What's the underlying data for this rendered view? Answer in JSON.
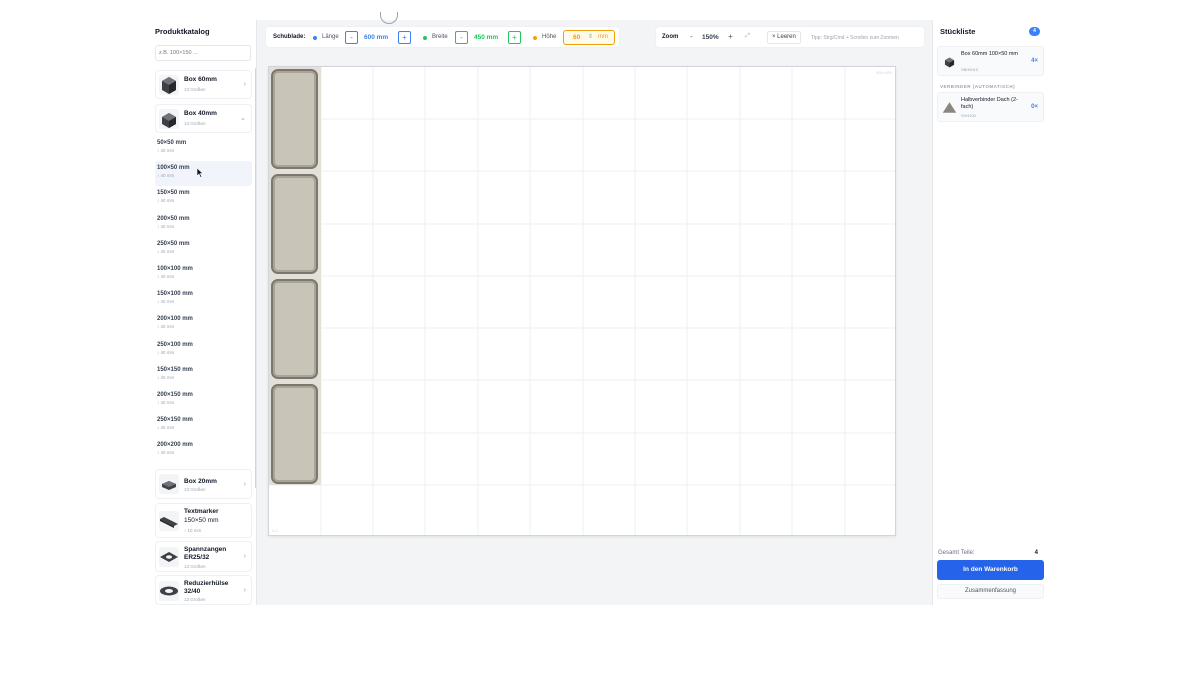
{
  "sidebar": {
    "title": "Produktkatalog",
    "search_placeholder": "z.B. 100×150 ...",
    "categories_top": [
      {
        "name": "Box 60mm",
        "sub": "13 Größen",
        "expanded": false
      },
      {
        "name": "Box 40mm",
        "sub": "13 Größen",
        "expanded": true
      }
    ],
    "sizes": [
      {
        "name": "50×50 mm",
        "h": "↕ 40 mm"
      },
      {
        "name": "100×50 mm",
        "h": "↕ 40 mm"
      },
      {
        "name": "150×50 mm",
        "h": "↕ 40 mm"
      },
      {
        "name": "200×50 mm",
        "h": "↕ 40 mm"
      },
      {
        "name": "250×50 mm",
        "h": "↕ 40 mm"
      },
      {
        "name": "100×100 mm",
        "h": "↕ 40 mm"
      },
      {
        "name": "150×100 mm",
        "h": "↕ 40 mm"
      },
      {
        "name": "200×100 mm",
        "h": "↕ 40 mm"
      },
      {
        "name": "250×100 mm",
        "h": "↕ 40 mm"
      },
      {
        "name": "150×150 mm",
        "h": "↕ 40 mm"
      },
      {
        "name": "200×150 mm",
        "h": "↕ 40 mm"
      },
      {
        "name": "250×150 mm",
        "h": "↕ 40 mm"
      },
      {
        "name": "200×200 mm",
        "h": "↕ 40 mm"
      }
    ],
    "categories_bottom": [
      {
        "name": "Box 20mm",
        "sub": "13 Größen"
      },
      {
        "name": "Textmarker",
        "name2": "150×50 mm",
        "sub": "↕ 10 mm"
      },
      {
        "name": "Spannzangen",
        "name2": "ER25/32",
        "sub": "13 Größen"
      },
      {
        "name": "Reduzierhülse",
        "name2": "32/40",
        "sub": "13 Größen"
      }
    ]
  },
  "toolbar": {
    "drawer_label": "Schublade:",
    "length_label": "Länge",
    "length_value": "600 mm",
    "width_label": "Breite",
    "width_value": "450 mm",
    "height_label": "Höhe",
    "height_value": "60",
    "height_unit": "mm",
    "minus": "-",
    "plus": "+",
    "stepper": "⇕",
    "zoom_label": "Zoom",
    "zoom_value": "150%",
    "fit": "⤢",
    "clear_label": "× Leeren",
    "tip": "Tipp: Strg/Cmd + Scrollen zum Zoomen"
  },
  "canvas": {
    "tag": "600×450",
    "corner": "0,0",
    "box_count": 4
  },
  "colors": {
    "length": "#3b82f6",
    "width": "#22c55e",
    "height": "#f59e0b",
    "primary": "#2563eb"
  },
  "bom": {
    "title": "Stückliste",
    "badge": "4",
    "items": [
      {
        "name": "Box 60mm 100×50 mm",
        "code": "SBH6010",
        "qty": "4×"
      }
    ],
    "connectors_title": "VERBINDER (AUTOMATISCH)",
    "connectors": [
      {
        "name": "Halbverbinder Dach (2-fach)",
        "code": "SVH100",
        "qty": "0×"
      }
    ],
    "total_label": "Gesamt Teile:",
    "total_value": "4",
    "cart_button": "In den Warenkorb",
    "summary_button": "Zusammenfassung"
  }
}
